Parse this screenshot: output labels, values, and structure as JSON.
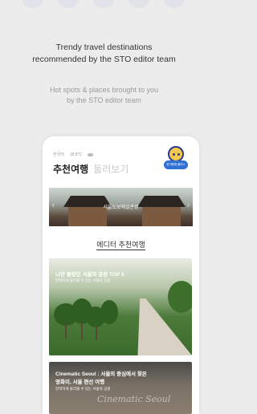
{
  "headline": {
    "line1": "Trendy travel destinations",
    "line2": "recommended by the STO editor team"
  },
  "subline": {
    "line1": "Hot spots & places brought to you",
    "line2": "by the STO editor team"
  },
  "phone": {
    "status": {
      "weather": "한국어",
      "temp": "18.8°C"
    },
    "tabs": [
      "추천여행",
      "둘러보기"
    ],
    "badge_label": "맞여행에 플러스",
    "banner": {
      "label": "서울도보해설관광"
    },
    "section_title": "에디터 추천여행",
    "cards": [
      {
        "title": "나만 몰랐던 서울의 공원 TOP 5",
        "subtitle": "한적하게 둘러볼 수 있는 서울의 공원"
      },
      {
        "title_line1": "Cinematic Seoul : 서울의 중심에서 찾은",
        "title_line2": "영화미, 서울 편선 여행",
        "subtitle": "한적하게 둘러볼 수 있는 서울의 공원",
        "script": "Cinematic Seoul"
      }
    ]
  },
  "colors": {
    "background": "#ececec",
    "accent": "#2f6fd6",
    "mascot": "#f2c94c"
  }
}
